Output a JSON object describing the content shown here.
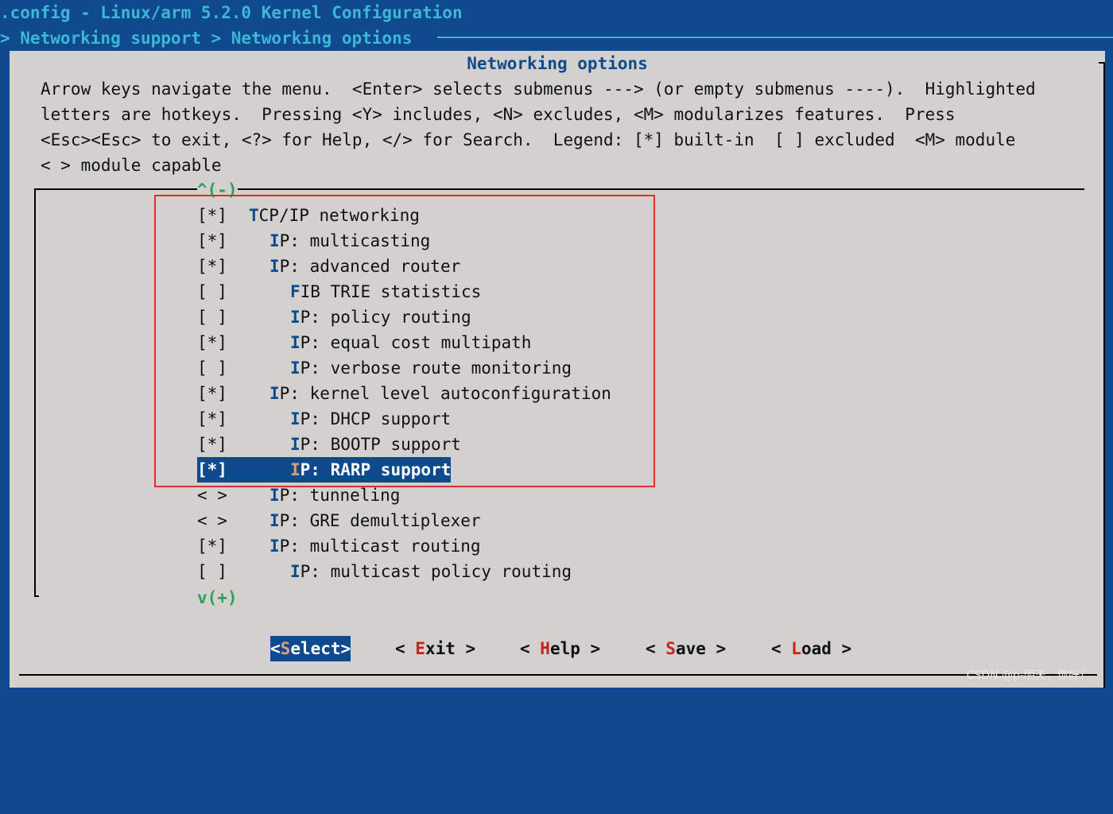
{
  "window": {
    "title": ".config - Linux/arm 5.2.0 Kernel Configuration",
    "breadcrumb": "> Networking support > Networking options"
  },
  "dialog": {
    "title": "Networking options",
    "help_lines": [
      "Arrow keys navigate the menu.  <Enter> selects submenus ---> (or empty submenus ----).  Highlighted",
      "letters are hotkeys.  Pressing <Y> includes, <N> excludes, <M> modularizes features.  Press",
      "<Esc><Esc> to exit, <?> for Help, </> for Search.  Legend: [*] built-in  [ ] excluded  <M> module",
      "< > module capable"
    ],
    "scroll_up": "^(-)",
    "scroll_down": "v(+)"
  },
  "menu": {
    "items": [
      {
        "state": "[*]",
        "hotkey": "T",
        "rest": "CP/IP networking",
        "indent": 0
      },
      {
        "state": "[*]",
        "hotkey": "I",
        "rest": "P: multicasting",
        "indent": 1
      },
      {
        "state": "[*]",
        "hotkey": "I",
        "rest": "P: advanced router",
        "indent": 1
      },
      {
        "state": "[ ]",
        "hotkey": "F",
        "rest": "IB TRIE statistics",
        "indent": 2
      },
      {
        "state": "[ ]",
        "hotkey": "I",
        "rest": "P: policy routing",
        "indent": 2
      },
      {
        "state": "[*]",
        "hotkey": "I",
        "rest": "P: equal cost multipath",
        "indent": 2
      },
      {
        "state": "[ ]",
        "hotkey": "I",
        "rest": "P: verbose route monitoring",
        "indent": 2
      },
      {
        "state": "[*]",
        "hotkey": "I",
        "rest": "P: kernel level autoconfiguration",
        "indent": 1
      },
      {
        "state": "[*]",
        "hotkey": "I",
        "rest": "P: DHCP support",
        "indent": 2
      },
      {
        "state": "[*]",
        "hotkey": "I",
        "rest": "P: BOOTP support",
        "indent": 2
      },
      {
        "state": "[*]",
        "hotkey": "I",
        "rest": "P: RARP support",
        "indent": 2,
        "selected": true
      },
      {
        "state": "< >",
        "hotkey": "I",
        "rest": "P: tunneling",
        "indent": 1
      },
      {
        "state": "< >",
        "hotkey": "I",
        "rest": "P: GRE demultiplexer",
        "indent": 1
      },
      {
        "state": "[*]",
        "hotkey": "I",
        "rest": "P: multicast routing",
        "indent": 1
      },
      {
        "state": "[ ]",
        "hotkey": "I",
        "rest": "P: multicast policy routing",
        "indent": 2
      }
    ]
  },
  "buttons": {
    "select": {
      "pre": "<",
      "key": "S",
      "post": "elect>"
    },
    "exit": {
      "pre": "< ",
      "key": "E",
      "post": "xit >"
    },
    "help": {
      "pre": "< ",
      "key": "H",
      "post": "elp >"
    },
    "save": {
      "pre": "< ",
      "key": "S",
      "post": "ave >"
    },
    "load": {
      "pre": "< ",
      "key": "L",
      "post": "oad >"
    }
  },
  "watermark": "CSDN @p-明天，你好！",
  "colors": {
    "terminal_blue": "#0f4a8c",
    "title_cyan": "#3fb6d8",
    "dialog_gray": "#d3d1ce",
    "hotkey_red": "#c8201e",
    "scroll_green": "#2aa05a",
    "annotation_red": "#e22b2b"
  }
}
